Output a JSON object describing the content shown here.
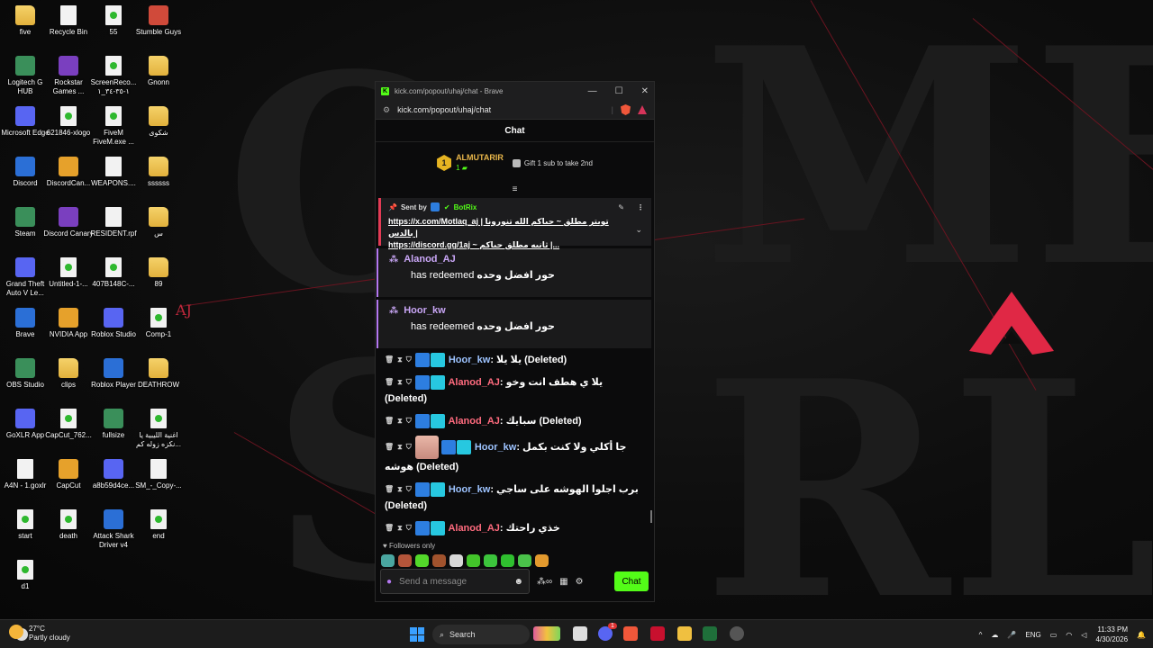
{
  "desktop": {
    "wallpaper_text": [
      "O",
      "ME",
      "S",
      "RLA"
    ],
    "icons": [
      {
        "label": "five",
        "kind": "folder"
      },
      {
        "label": "Recycle Bin",
        "kind": "file"
      },
      {
        "label": "55",
        "kind": "green"
      },
      {
        "label": "Stumble Guys",
        "kind": "app"
      },
      {
        "label": "Logitech G HUB",
        "kind": "app"
      },
      {
        "label": "Rockstar Games ...",
        "kind": "app"
      },
      {
        "label": "ScreenReco... ١-٣٥-٣٤_١",
        "kind": "green"
      },
      {
        "label": "Gnonn",
        "kind": "folder"
      },
      {
        "label": "Microsoft Edge",
        "kind": "app"
      },
      {
        "label": "621846-xlogo",
        "kind": "green"
      },
      {
        "label": "FiveM FiveM.exe ...",
        "kind": "green"
      },
      {
        "label": "شكوى",
        "kind": "folder"
      },
      {
        "label": "Discord",
        "kind": "app"
      },
      {
        "label": "DiscordCan...",
        "kind": "app"
      },
      {
        "label": "WEAPONS....",
        "kind": "file"
      },
      {
        "label": "ssssss",
        "kind": "folder"
      },
      {
        "label": "Steam",
        "kind": "app"
      },
      {
        "label": "Discord Canary",
        "kind": "app"
      },
      {
        "label": "RESIDENT.rpf",
        "kind": "file"
      },
      {
        "label": "س",
        "kind": "folder"
      },
      {
        "label": "Grand Theft Auto V Le...",
        "kind": "app"
      },
      {
        "label": "Untitled-1-...",
        "kind": "green"
      },
      {
        "label": "407B148C-...",
        "kind": "green"
      },
      {
        "label": "89",
        "kind": "folder"
      },
      {
        "label": "Brave",
        "kind": "app"
      },
      {
        "label": "NVIDIA App",
        "kind": "app"
      },
      {
        "label": "Roblox Studio",
        "kind": "app"
      },
      {
        "label": "Comp-1",
        "kind": "green"
      },
      {
        "label": "OBS Studio",
        "kind": "app"
      },
      {
        "label": "clips",
        "kind": "folder"
      },
      {
        "label": "Roblox Player",
        "kind": "app"
      },
      {
        "label": "DEATHROW",
        "kind": "folder"
      },
      {
        "label": "GoXLR App",
        "kind": "app"
      },
      {
        "label": "CapCut_762...",
        "kind": "green"
      },
      {
        "label": "fullsize",
        "kind": "app"
      },
      {
        "label": "اغنية الليبية يا نكزه زوله كم...",
        "kind": "green"
      },
      {
        "label": "A4N - 1.goxlr",
        "kind": "file"
      },
      {
        "label": "CapCut",
        "kind": "app"
      },
      {
        "label": "a8b59d4ce...",
        "kind": "app"
      },
      {
        "label": "SM_-_Copy-...",
        "kind": "file"
      },
      {
        "label": "start",
        "kind": "green"
      },
      {
        "label": "death",
        "kind": "green"
      },
      {
        "label": "Attack Shark Driver v4",
        "kind": "app"
      },
      {
        "label": "end",
        "kind": "green"
      },
      {
        "label": "d1",
        "kind": "green"
      }
    ],
    "overlay_text": "AJ"
  },
  "browser": {
    "window_title": "kick.com/popout/uhaj/chat - Brave",
    "url": "kick.com/popout/uhaj/chat",
    "controls": {
      "minimize": "—",
      "maximize": "☐",
      "close": "✕"
    }
  },
  "chat": {
    "header": "Chat",
    "leaderboard": {
      "rank": "1",
      "name": "ALMUTARIR",
      "count": "1",
      "gift_text": "Gift 1 sub to take 2nd"
    },
    "pinned": {
      "sent_by_label": "Sent by",
      "sender": "BotRix",
      "line1": "https://x.com/Motlaq_aj | تويتر مطلق ~ حياكم الله تنورونا بالدس |",
      "line2": "https://discord.gg/1aj ~ ثانيه مطلق حياكم |..."
    },
    "redeems": [
      {
        "user": "Alanod_AJ",
        "action": "has redeemed",
        "reward": "حور افضل وحده"
      },
      {
        "user": "Hoor_kw",
        "action": "has redeemed",
        "reward": "حور افضل وحده"
      }
    ],
    "messages": [
      {
        "user": "Hoor_kw",
        "user_class": "u-hoor",
        "text": "يلا يلا",
        "deleted": "(Deleted)",
        "avatar": false
      },
      {
        "user": "Alanod_AJ",
        "user_class": "u-alanod",
        "text": "يلا ي هطف انت وخو",
        "deleted": "(Deleted)",
        "avatar": false
      },
      {
        "user": "Alanod_AJ",
        "user_class": "u-alanod",
        "text": "سبايك",
        "deleted": "(Deleted)",
        "avatar": false
      },
      {
        "user": "Hoor_kw",
        "user_class": "u-hoor",
        "text": "جا أكلي ولا كنت بكمل هوشه",
        "deleted": "(Deleted)",
        "avatar": true
      },
      {
        "user": "Hoor_kw",
        "user_class": "u-hoor",
        "text": "برب اجلوا الهوشه على ساجي",
        "deleted": "(Deleted)",
        "avatar": false
      },
      {
        "user": "Alanod_AJ",
        "user_class": "u-alanod",
        "text": "خذي راحتك",
        "deleted": "",
        "avatar": false
      }
    ],
    "followers_only": "Followers only",
    "input_placeholder": "Send a message",
    "send_label": "Chat"
  },
  "taskbar": {
    "weather_temp": "27°C",
    "weather_desc": "Partly cloudy",
    "search_placeholder": "Search",
    "language": "ENG",
    "time": "11:33 PM",
    "date": "4/30/2026",
    "discord_badge": "1"
  }
}
